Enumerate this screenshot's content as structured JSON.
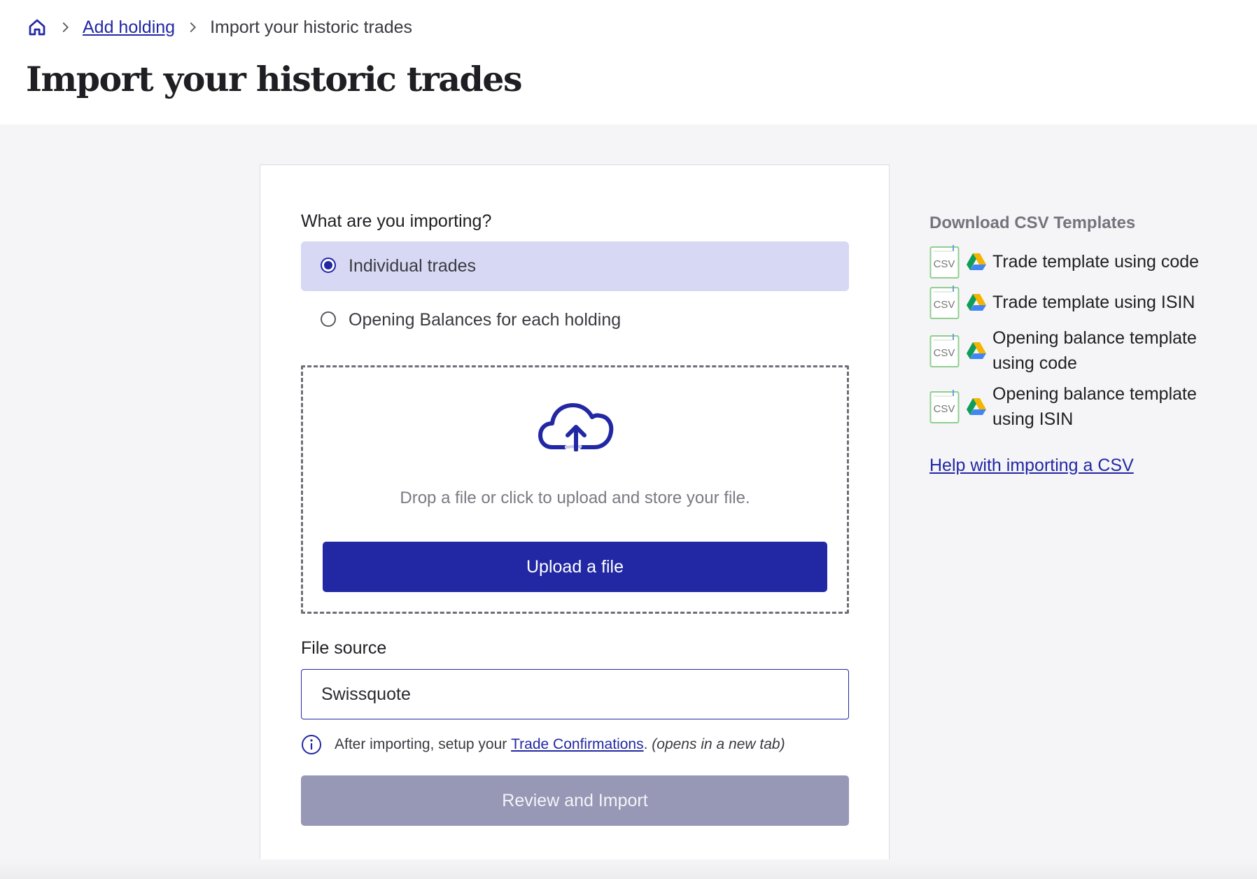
{
  "breadcrumb": {
    "parent": "Add holding",
    "current": "Import your historic trades"
  },
  "page": {
    "title": "Import your historic trades"
  },
  "form": {
    "question": "What are you importing?",
    "options": [
      {
        "label": "Individual trades",
        "selected": true
      },
      {
        "label": "Opening Balances for each holding",
        "selected": false
      }
    ],
    "dropzone": {
      "text": "Drop a file or click to upload and store your file.",
      "upload_label": "Upload a file"
    },
    "file_source": {
      "label": "File source",
      "value": "Swissquote"
    },
    "hint": {
      "prefix": "After importing, setup your",
      "link": "Trade Confirmations",
      "suffix": ".",
      "note": "(opens in a new tab)"
    },
    "review_label": "Review and Import"
  },
  "sidebar": {
    "title": "Download CSV Templates",
    "csv_badge": "CSV",
    "templates": [
      {
        "label": "Trade template using code"
      },
      {
        "label": "Trade template using ISIN"
      },
      {
        "label": "Opening balance template using code"
      },
      {
        "label": "Opening balance template using ISIN"
      }
    ],
    "help_link": "Help with importing a CSV"
  },
  "colors": {
    "primary": "#2228a4",
    "selected_bg": "#d7d8f4",
    "disabled_button": "#9797b6",
    "page_bg": "#f5f5f7"
  }
}
